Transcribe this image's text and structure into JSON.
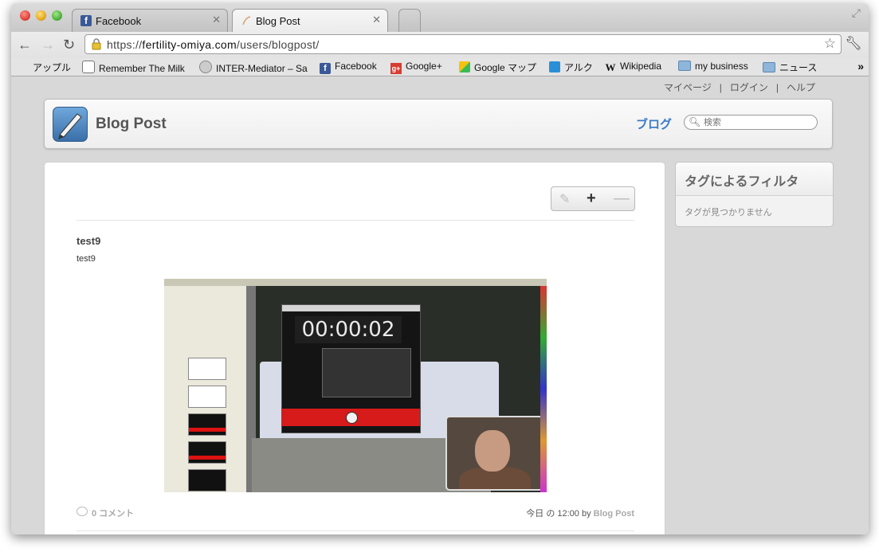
{
  "browser": {
    "tabs": [
      {
        "title": "Facebook",
        "close": "✕"
      },
      {
        "title": "Blog Post",
        "close": "✕"
      }
    ],
    "url_prefix": "https://",
    "url_domain": "fertility-omiya.com",
    "url_path": "/users/blogpost/",
    "bookmarks": [
      {
        "label": "アップル",
        "icon": "apple-icon"
      },
      {
        "label": "Remember The Milk",
        "icon": "cow-icon"
      },
      {
        "label": "INTER-Mediator – Sa",
        "icon": "globe-icon"
      },
      {
        "label": "Facebook",
        "icon": "facebook-icon"
      },
      {
        "label": "Google+",
        "icon": "google-plus-icon"
      },
      {
        "label": "Google マップ",
        "icon": "google-maps-icon"
      },
      {
        "label": "アルク",
        "icon": "alc-icon"
      },
      {
        "label": "Wikipedia",
        "icon": "wikipedia-icon"
      },
      {
        "label": "my business",
        "icon": "folder-icon"
      },
      {
        "label": "ニュース",
        "icon": "folder-icon"
      }
    ],
    "bookmarks_more": "»"
  },
  "site": {
    "toplinks": [
      "マイページ",
      "ログイン",
      "ヘルプ"
    ],
    "separator": "|",
    "title": "Blog Post",
    "nav_blog": "ブログ",
    "search_placeholder": "検索"
  },
  "post": {
    "title": "test9",
    "body": "test9",
    "screenshot": {
      "timer": "00:00:02"
    },
    "comments": "0 コメント",
    "date_prefix": "今日 の 12:00 by ",
    "author": "Blog Post"
  },
  "sidebar": {
    "title": "タグによるフィルタ",
    "empty": "タグが見つかりません"
  },
  "colors": {
    "link_blue": "#3d7bc8",
    "record_red": "#d71a1a",
    "page_bg": "#d8d8d8"
  }
}
